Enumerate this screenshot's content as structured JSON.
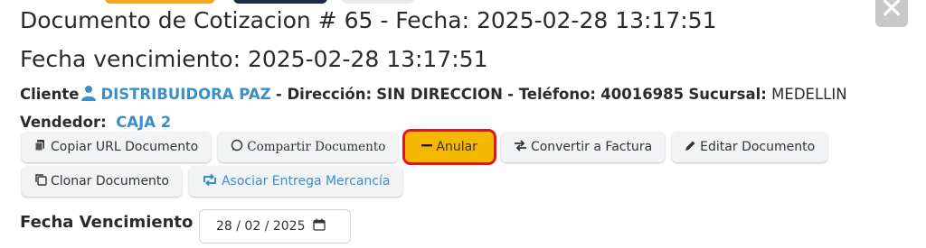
{
  "header": {
    "title_line1": "Documento de Cotizacion # 65 - Fecha: 2025-02-28 13:17:51",
    "title_line2": "Fecha vencimiento: 2025-02-28 13:17:51"
  },
  "client": {
    "label": "Cliente",
    "name": "DISTRIBUIDORA PAZ",
    "address_label": "- Dirección:",
    "address": "SIN DIRECCION",
    "phone_label": "- Teléfono:",
    "phone": "40016985",
    "branch_label": "Sucursal:",
    "branch": "MEDELLIN",
    "seller_label": "Vendedor:",
    "seller": "CAJA 2"
  },
  "actions": {
    "copy_url": "Copiar URL Documento",
    "share": "Compartir Documento",
    "void": "Anular",
    "convert": "Convertir a Factura",
    "edit": "Editar Documento",
    "clone": "Clonar Documento",
    "associate": "Asociar Entrega Mercancía"
  },
  "expiry": {
    "label": "Fecha Vencimiento",
    "value": "28 / 02 / 2025"
  },
  "colors": {
    "accent_blue": "#3a8fc9",
    "void_button": "#f5b800",
    "highlight_border": "#e0141b"
  }
}
